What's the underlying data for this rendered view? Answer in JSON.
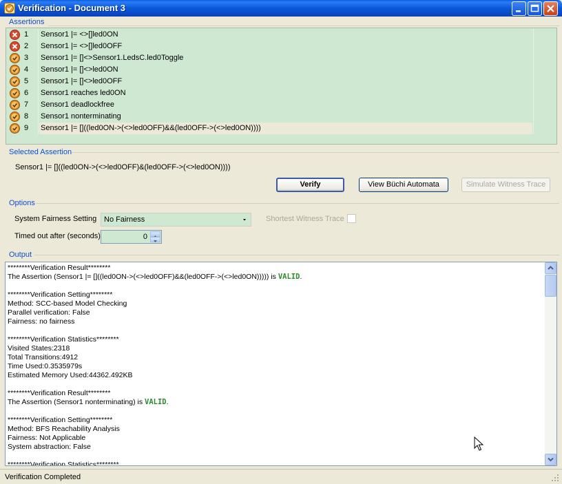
{
  "window": {
    "title": "Verification - Document 3"
  },
  "assertions": {
    "label": "Assertions",
    "rows": [
      {
        "num": "1",
        "text": "Sensor1 |= <>[]led0ON",
        "status": "fail"
      },
      {
        "num": "2",
        "text": "Sensor1 |= <>[]led0OFF",
        "status": "fail"
      },
      {
        "num": "3",
        "text": "Sensor1 |= []<>Sensor1.LedsC.led0Toggle",
        "status": "pass"
      },
      {
        "num": "4",
        "text": "Sensor1 |= []<>led0ON",
        "status": "pass"
      },
      {
        "num": "5",
        "text": "Sensor1 |= []<>led0OFF",
        "status": "pass"
      },
      {
        "num": "6",
        "text": "Sensor1 reaches led0ON",
        "status": "pass"
      },
      {
        "num": "7",
        "text": "Sensor1 deadlockfree",
        "status": "pass"
      },
      {
        "num": "8",
        "text": "Sensor1 nonterminating",
        "status": "pass"
      },
      {
        "num": "9",
        "text": "Sensor1 |= []((led0ON->(<>led0OFF)&&(led0OFF->(<>led0ON))))",
        "status": "pass"
      }
    ],
    "selected_row": 9
  },
  "selected_assertion": {
    "label": "Selected Assertion",
    "text": "Sensor1 |= []((led0ON->(<>led0OFF)&(led0OFF->(<>led0ON))))",
    "verify_label": "Verify",
    "buchi_label": "View Büchi Automata",
    "simulate_label": "Simulate Witness Trace"
  },
  "options": {
    "label": "Options",
    "fairness_label": "System Fairness Setting",
    "fairness_value": "No Fairness",
    "shortest_label": "Shortest Witness Trace",
    "shortest_checked": false,
    "timeout_label": "Timed out after (seconds)",
    "timeout_value": "0"
  },
  "output": {
    "label": "Output",
    "lines": [
      {
        "t": "********Verification Result********"
      },
      {
        "t": "The Assertion (Sensor1 |= []((led0ON->(<>led0OFF)&&(led0OFF->(<>led0ON))))) is ",
        "valid": "VALID",
        "after": "."
      },
      {
        "t": ""
      },
      {
        "t": "********Verification Setting********"
      },
      {
        "t": "Method: SCC-based Model Checking"
      },
      {
        "t": "Parallel verification: False"
      },
      {
        "t": "Fairness: no fairness"
      },
      {
        "t": ""
      },
      {
        "t": "********Verification Statistics********"
      },
      {
        "t": "Visited States:2318"
      },
      {
        "t": "Total Transitions:4912"
      },
      {
        "t": "Time Used:0.3535979s"
      },
      {
        "t": "Estimated Memory Used:44362.492KB"
      },
      {
        "t": ""
      },
      {
        "t": "********Verification Result********"
      },
      {
        "t": "The Assertion (Sensor1 nonterminating) is ",
        "valid": "VALID",
        "after": "."
      },
      {
        "t": ""
      },
      {
        "t": "********Verification Setting********"
      },
      {
        "t": "Method: BFS Reachability Analysis"
      },
      {
        "t": "Fairness: Not Applicable"
      },
      {
        "t": "System abstraction: False"
      },
      {
        "t": ""
      },
      {
        "t": "********Verification Statistics********"
      }
    ]
  },
  "status": {
    "text": "Verification Completed"
  },
  "colors": {
    "list_bg": "#cfe8d2",
    "valid_text": "#2a8c2a",
    "section_label": "#0b4fd0",
    "fail_icon": "#d9492f",
    "pass_icon": "#e08a1e"
  },
  "icons": {
    "fail": "error-x-icon",
    "pass": "check-badge-icon"
  }
}
